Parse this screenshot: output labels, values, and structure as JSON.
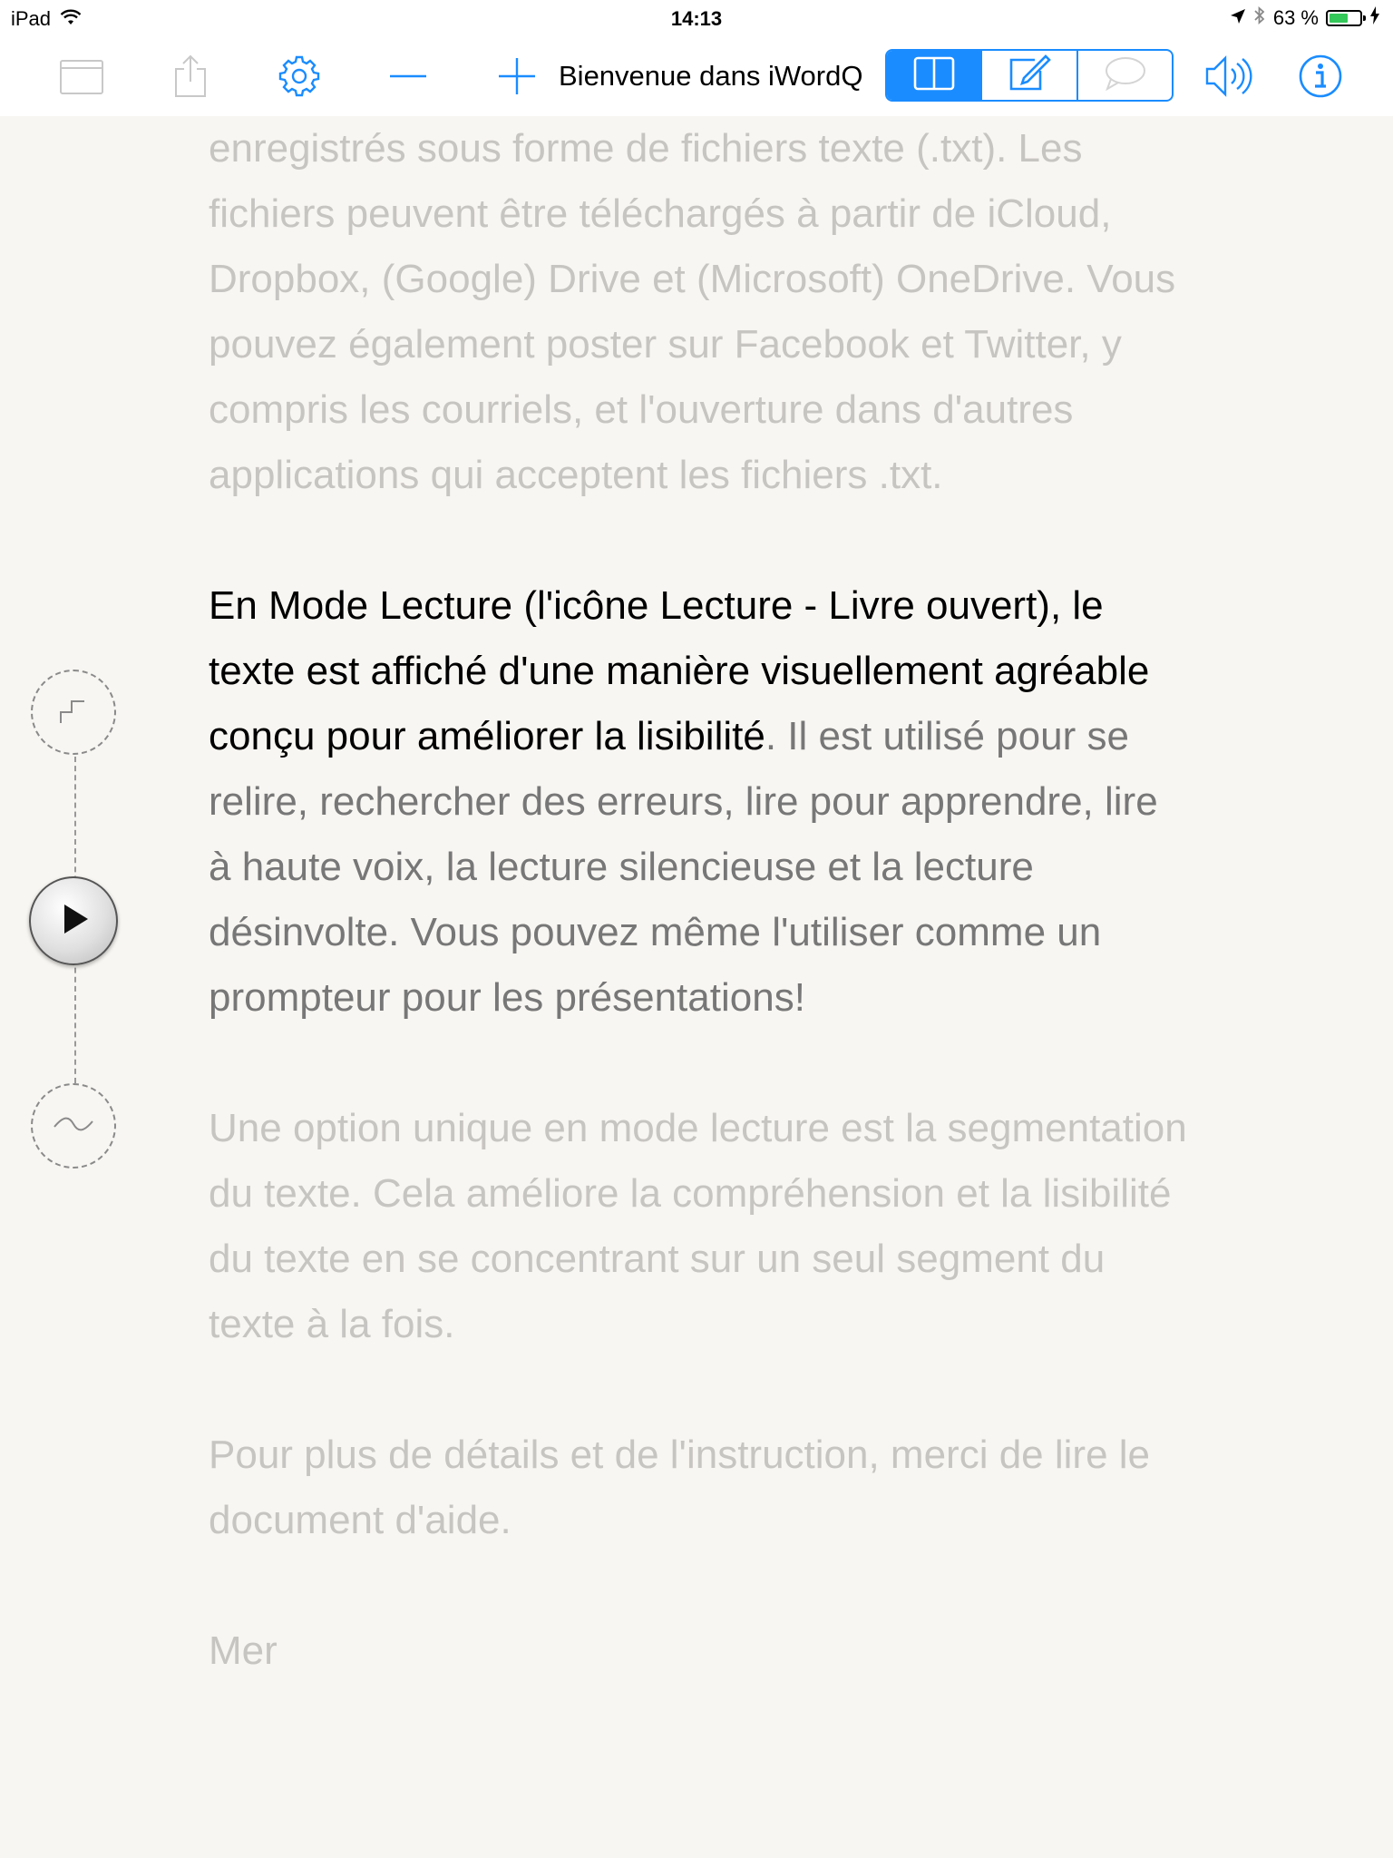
{
  "status_bar": {
    "device": "iPad",
    "time": "14:13",
    "battery_percent": "63 %",
    "battery_level": 0.63,
    "battery_color": "#34c759"
  },
  "toolbar": {
    "title": "Bienvenue dans iWordQ",
    "accent_color": "#1a8cff",
    "icons": [
      "folder-icon",
      "share-icon",
      "gear-icon",
      "minus-icon",
      "plus-icon",
      "book-open-icon",
      "edit-icon",
      "speech-bubble-icon",
      "speaker-icon",
      "info-icon"
    ]
  },
  "content": {
    "para1": "enregistrés sous forme de fichiers texte (.txt). Les fichiers peuvent être téléchargés à partir de iCloud, Dropbox, (Google) Drive et (Microsoft) OneDrive. Vous pouvez également poster sur Facebook et Twitter, y compris les courriels, et l'ouverture dans d'autres applications qui acceptent les fichiers .txt.",
    "para2_highlight": "En Mode Lecture (l'icône Lecture - Livre ouvert), le texte est affiché d'une manière visuellement agréable conçu pour améliorer la lisibilité",
    "para2_rest": ". Il est utilisé pour se relire, rechercher des erreurs, lire pour apprendre, lire à haute voix, la lecture silencieuse et la lecture désinvolte. Vous pouvez même l'utiliser comme un prompteur pour les présentations!",
    "para3": "Une option unique en mode lecture est la segmentation du texte. Cela améliore la compréhension et la lisibilité du texte en se concentrant sur un seul segment du texte à la fois.",
    "para4": "Pour plus de détails et de l'instruction, merci de lire le document d'aide.",
    "para5": "Mer"
  }
}
